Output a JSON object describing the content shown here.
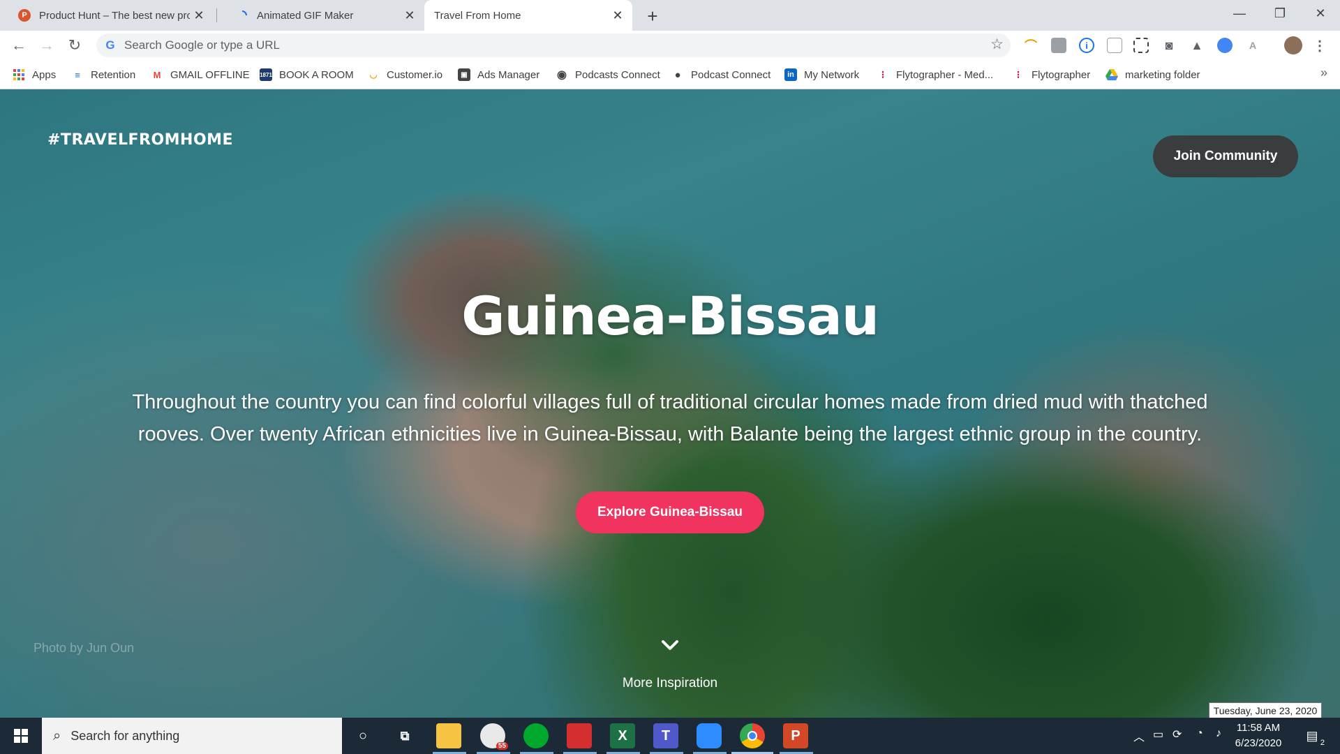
{
  "browser": {
    "tabs": [
      {
        "title": "Product Hunt – The best new pro",
        "favicon": "P",
        "favicon_color": "#da552f"
      },
      {
        "title": "Animated GIF Maker",
        "favicon": "",
        "favicon_color": "#1a73e8"
      },
      {
        "title": "Travel From Home",
        "favicon": "",
        "favicon_color": ""
      }
    ],
    "new_tab_symbol": "+",
    "window_controls": {
      "minimize": "—",
      "maximize": "❐",
      "close": "✕"
    },
    "nav": {
      "back": "←",
      "forward": "→",
      "reload": "↻"
    },
    "omnibox": {
      "placeholder": "Search Google or type a URL",
      "value": ""
    },
    "bookmarks": [
      {
        "label": "Apps",
        "icon": "apps-grid-icon"
      },
      {
        "label": "Retention",
        "icon": "retention-icon"
      },
      {
        "label": "GMAIL OFFLINE",
        "icon": "gmail-icon"
      },
      {
        "label": "BOOK A ROOM",
        "icon": "calendar-icon"
      },
      {
        "label": "Customer.io",
        "icon": "customerio-icon"
      },
      {
        "label": "Ads Manager",
        "icon": "ads-manager-icon"
      },
      {
        "label": "Podcasts Connect",
        "icon": "podcasts-icon"
      },
      {
        "label": "Podcast Connect",
        "icon": "apple-icon"
      },
      {
        "label": "My Network",
        "icon": "linkedin-icon"
      },
      {
        "label": "Flytographer - Med...",
        "icon": "flytographer-icon"
      },
      {
        "label": "Flytographer",
        "icon": "flytographer-icon"
      },
      {
        "label": "marketing folder",
        "icon": "google-drive-icon"
      }
    ],
    "bookmarks_overflow": "»",
    "bookmark_badge_1871": "1871"
  },
  "page": {
    "logo": "#TRAVELFROMHOME",
    "join_button": "Join Community",
    "title": "Guinea-Bissau",
    "description": "Throughout the country you can find colorful villages full of traditional circular homes made from dried mud with thatched rooves. Over twenty African ethnicities live in Guinea-Bissau, with Balante being the largest ethnic group in the country.",
    "explore_button": "Explore  Guinea-Bissau",
    "photo_credit": "Photo by Jun Oun",
    "more_inspiration": "More Inspiration",
    "accent_color": "#f0335f"
  },
  "tooltip": {
    "date": "Tuesday, June 23, 2020"
  },
  "taskbar": {
    "search_placeholder": "Search for anything",
    "badge_count": "55",
    "clock_time": "11:58 AM",
    "clock_date": "6/23/2020",
    "notification_count": "2"
  }
}
